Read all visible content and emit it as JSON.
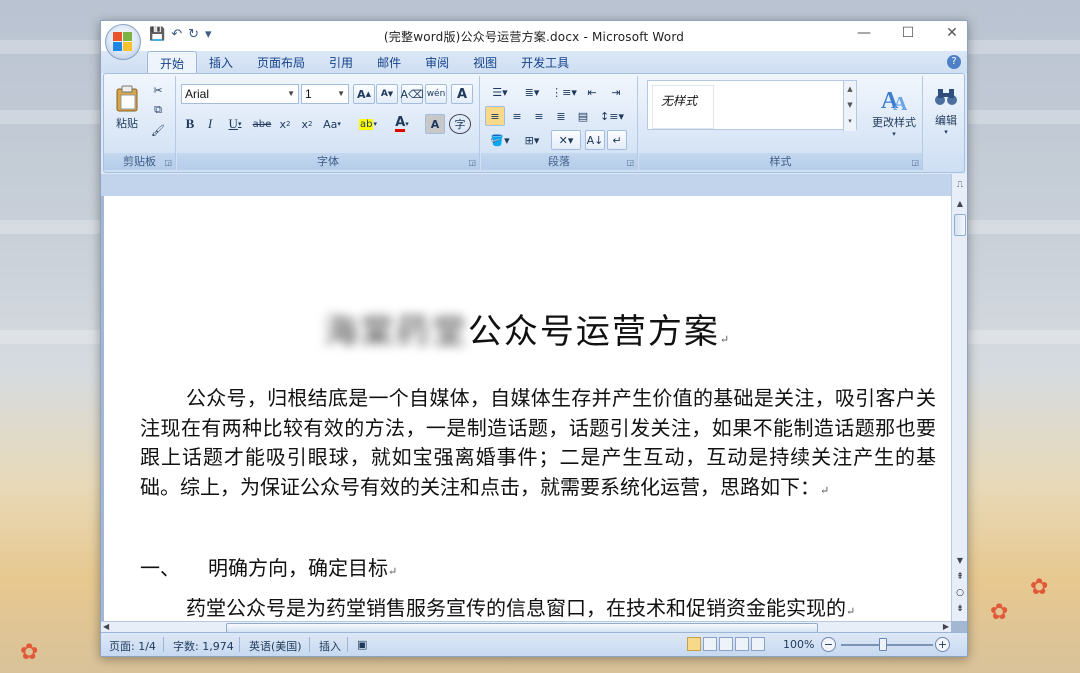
{
  "window": {
    "title": "(完整word版)公众号运营方案.docx - Microsoft Word",
    "controls": {
      "minimize": "—",
      "maximize": "☐",
      "close": "✕"
    }
  },
  "quick_access": {
    "save": "💾",
    "undo": "↶",
    "redo": "↻",
    "customize": "▾"
  },
  "tabs": [
    "开始",
    "插入",
    "页面布局",
    "引用",
    "邮件",
    "审阅",
    "视图",
    "开发工具"
  ],
  "ribbon": {
    "clipboard": {
      "label": "剪贴板",
      "paste": "粘贴"
    },
    "font": {
      "label": "字体",
      "name": "Arial",
      "size": "1",
      "grow": "A",
      "shrink": "A",
      "bold": "B",
      "italic": "I",
      "underline": "U",
      "strike": "abe",
      "subscript": "x",
      "superscript": "x",
      "case": "Aa",
      "highlight": "ab",
      "color": "A",
      "char_shading": "A",
      "enclose": "字"
    },
    "paragraph": {
      "label": "段落"
    },
    "styles": {
      "label": "样式",
      "item": "无样式",
      "change": "更改样式"
    },
    "editing": {
      "label": "编辑"
    }
  },
  "document": {
    "title_blurred": "海棠药堂",
    "title": "公众号运营方案",
    "para1": "公众号，归根结底是一个自媒体，自媒体生存并产生价值的基础是关注，吸引客户关注现在有两种比较有效的方法，一是制造话题，话题引发关注，如果不能制造话题那也要跟上话题才能吸引眼球，就如宝强离婚事件；二是产生互动，互动是持续关注产生的基础。综上，为保证公众号有效的关注和点击，就需要系统化运营，思路如下：",
    "heading1_num": "一、",
    "heading1": "明确方向，确定目标",
    "para2": "药堂公众号是为药堂销售服务宣传的信息窗口，在技术和促销资金能实现的",
    "para_mark": "↵"
  },
  "status": {
    "page": "页面: 1/4",
    "words": "字数: 1,974",
    "language": "英语(美国)",
    "mode": "插入",
    "zoom": "100%"
  },
  "colors": {
    "accent": "#15428b",
    "ribbon_bg": "#dce8f7",
    "window_border": "#8ea3c0"
  }
}
